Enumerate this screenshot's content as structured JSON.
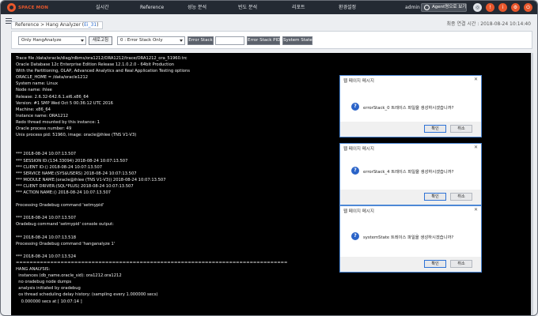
{
  "app": {
    "logo_text": "SPACE MON",
    "nav": [
      "실시간",
      "Reference",
      "성능 분석",
      "빈도 분석",
      "리포트",
      "환경설정"
    ],
    "user": "admin",
    "agent_button": "Agent명으로 보기",
    "icons": [
      "globe-icon",
      "alert-icon",
      "info-icon",
      "settings-icon",
      "power-icon"
    ],
    "accent": "#e8572c"
  },
  "breadcrumb": {
    "prefix": "Reference > Hang Analyzer (",
    "highlight": "Ei_31",
    "suffix": ")"
  },
  "last_connection": "최종 연결 시간 : 2018-08-24 10:14:40",
  "controls": {
    "mode_select": "Only HangAnalyze",
    "refresh_button": "새로고침",
    "pid_select": "0 : Error Stack Only",
    "error_stack_button": "Error Stack",
    "error_stack_pid_button": "Error Stack PID",
    "system_state_button": "System State"
  },
  "trace_lines": [
    "Trace file /data/oracle/diag/rdbms/ora1212/ORA1212/trace/ORA1212_ora_51960.trc",
    "Oracle Database 12c Enterprise Edition Release 12.1.0.2.0 - 64bit Production",
    "With the Partitioning, OLAP, Advanced Analytics and Real Application Testing options",
    "ORACLE_HOME = /data/oracle1212",
    "System name: Linux",
    "Node name: ihlee",
    "Release: 2.6.32-642.6.1.el6.x86_64",
    "Version: #1 SMP Wed Oct 5 00:36:12 UTC 2016",
    "Machine: x86_64",
    "Instance name: ORA1212",
    "Redo thread mounted by this instance: 1",
    "Oracle process number: 49",
    "Unix process pid: 51960, image: oracle@ihlee (TNS V1-V3)",
    "",
    "",
    "*** 2018-08-24 10:07:13.507",
    "*** SESSION ID:(134.33094) 2018-08-24 10:07:13.507",
    "*** CLIENT ID:() 2018-08-24 10:07:13.507",
    "*** SERVICE NAME:(SYS$USERS) 2018-08-24 10:07:13.507",
    "*** MODULE NAME:(oracle@ihlee (TNS V1-V3)) 2018-08-24 10:07:13.507",
    "*** CLIENT DRIVER:(SQL*PLUS) 2018-08-24 10:07:13.507",
    "*** ACTION NAME:() 2018-08-24 10:07:13.507",
    "",
    "Processing Oradebug command 'setmypid'",
    "",
    "*** 2018-08-24 10:07:13.507",
    "Oradebug command 'setmypid' console output:",
    "",
    "*** 2018-08-24 10:07:13.518",
    "Processing Oradebug command 'hanganalyze 1'",
    "",
    "*** 2018-08-24 10:07:13.524",
    "===============================================================================",
    "HANG ANALYSIS:",
    "  instances (db_name.oracle_sid): ora1212.ora1212",
    "  no oradebug node dumps",
    "  analysis initiated by oradebug",
    "  os thread scheduling delay history: (sampling every 1.000000 secs)",
    "    0.000000 secs at [ 10:07:14 ]"
  ],
  "dialogs": [
    {
      "title": "웹 페이지 메시지",
      "message": "errorStack_0 트레이스 파일을 생성하시겠습니까?",
      "ok": "확인",
      "cancel": "취소"
    },
    {
      "title": "웹 페이지 메시지",
      "message": "errorStack_4 트레이스 파일을 생성하시겠습니까?",
      "ok": "확인",
      "cancel": "취소"
    },
    {
      "title": "웹 페이지 메시지",
      "message": "systemState 트레이스 파일을 생성하시겠습니까?",
      "ok": "확인",
      "cancel": "취소"
    }
  ]
}
